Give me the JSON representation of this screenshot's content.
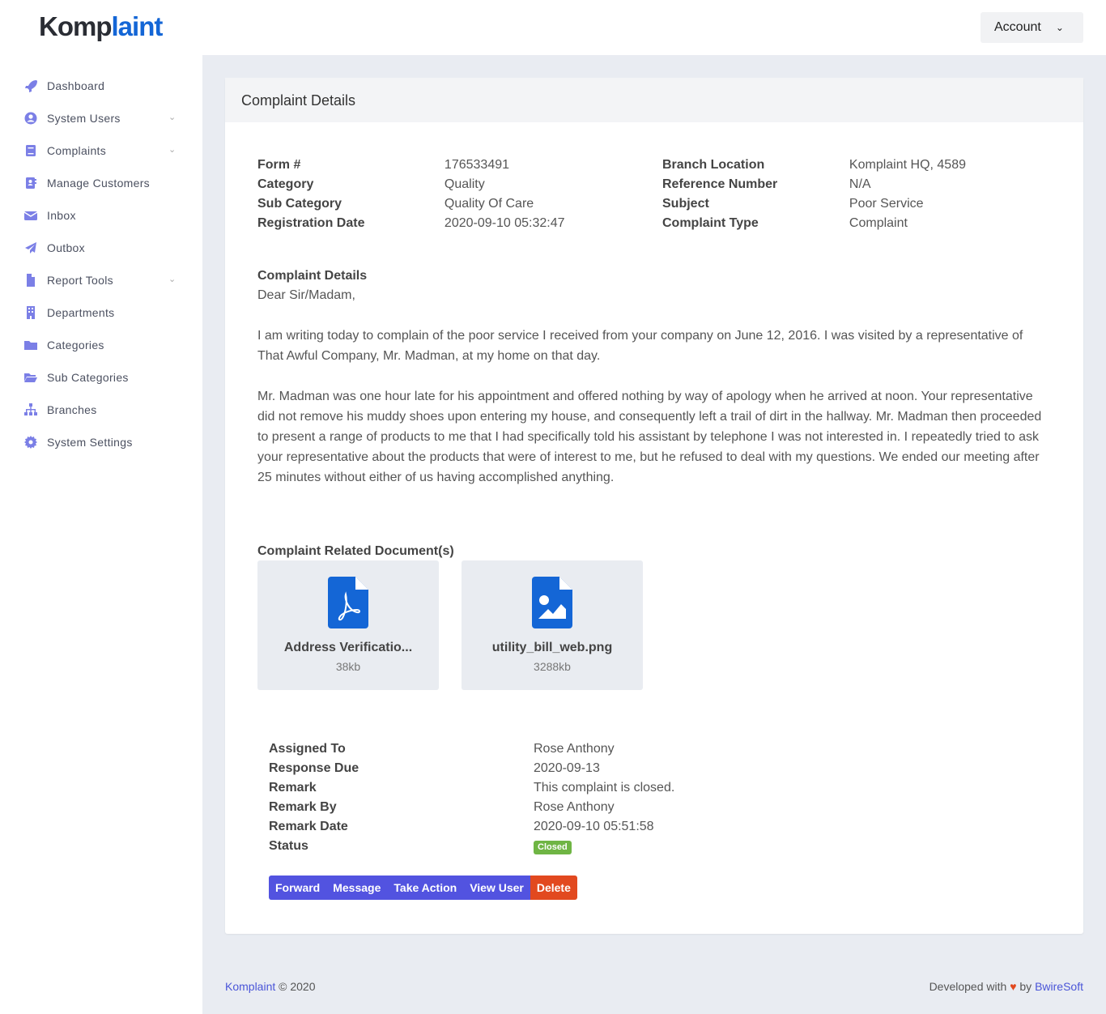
{
  "brand": {
    "part1": "Komp",
    "part2": "laint"
  },
  "header": {
    "account_label": "Account"
  },
  "sidebar": {
    "items": [
      {
        "label": "Dashboard",
        "icon": "rocket-icon",
        "chev": false
      },
      {
        "label": "System Users",
        "icon": "user-circle-icon",
        "chev": true
      },
      {
        "label": "Complaints",
        "icon": "book-icon",
        "chev": true
      },
      {
        "label": "Manage Customers",
        "icon": "address-book-icon",
        "chev": false
      },
      {
        "label": "Inbox",
        "icon": "envelope-icon",
        "chev": false
      },
      {
        "label": "Outbox",
        "icon": "paper-plane-icon",
        "chev": false
      },
      {
        "label": "Report Tools",
        "icon": "file-icon",
        "chev": true
      },
      {
        "label": "Departments",
        "icon": "building-icon",
        "chev": false
      },
      {
        "label": "Categories",
        "icon": "folder-icon",
        "chev": false
      },
      {
        "label": "Sub Categories",
        "icon": "folder-open-icon",
        "chev": false
      },
      {
        "label": "Branches",
        "icon": "sitemap-icon",
        "chev": false
      },
      {
        "label": "System Settings",
        "icon": "cog-icon",
        "chev": false
      }
    ]
  },
  "card": {
    "title": "Complaint Details",
    "details": [
      [
        "Form #",
        "176533491",
        "Branch Location",
        "Komplaint HQ, 4589"
      ],
      [
        "Category",
        "Quality",
        "Reference Number",
        "N/A"
      ],
      [
        "Sub Category",
        "Quality Of Care",
        "Subject",
        "Poor Service"
      ],
      [
        "Registration Date",
        "2020-09-10 05:32:47",
        "Complaint Type",
        "Complaint"
      ]
    ],
    "complaint_heading": "Complaint Details",
    "salutation": "Dear Sir/Madam,",
    "para1": "I am writing today to complain of the poor service I received from your company on June 12, 2016. I was visited by a representative of That Awful Company, Mr. Madman, at my home on that day.",
    "para2": "Mr. Madman was one hour late for his appointment and offered nothing by way of apology when he arrived at noon. Your representative did not remove his muddy shoes upon entering my house, and consequently left a trail of dirt in the hallway. Mr. Madman then proceeded to present a range of products to me that I had specifically told his assistant by telephone I was not interested in. I repeatedly tried to ask your representative about the products that were of interest to me, but he refused to deal with my questions. We ended our meeting after 25 minutes without either of us having accomplished anything.",
    "docs_heading": "Complaint Related Document(s)",
    "docs": [
      {
        "name": "Address Verificatio...",
        "size": "38kb",
        "icon": "file-pdf-icon"
      },
      {
        "name": "utility_bill_web.png",
        "size": "3288kb",
        "icon": "file-image-icon"
      }
    ],
    "assign": [
      [
        "Assigned To",
        "Rose Anthony"
      ],
      [
        "Response Due",
        "2020-09-13"
      ],
      [
        "Remark",
        "This complaint is closed."
      ],
      [
        "Remark By",
        "Rose Anthony"
      ],
      [
        "Remark Date",
        "2020-09-10 05:51:58"
      ]
    ],
    "status_label": "Status",
    "status": "Closed",
    "buttons": {
      "forward": "Forward",
      "message": "Message",
      "take_action": "Take Action",
      "view_user": "View User",
      "delete": "Delete"
    }
  },
  "footer": {
    "brand": "Komplaint",
    "copy": "© 2020",
    "dev": "Developed with",
    "by": "by",
    "company": "BwireSoft"
  },
  "colors": {
    "accent": "#5253e0",
    "brand_blue": "#1466d6",
    "danger": "#e2491f",
    "success": "#6fb544",
    "icon": "#7b7fe6"
  }
}
